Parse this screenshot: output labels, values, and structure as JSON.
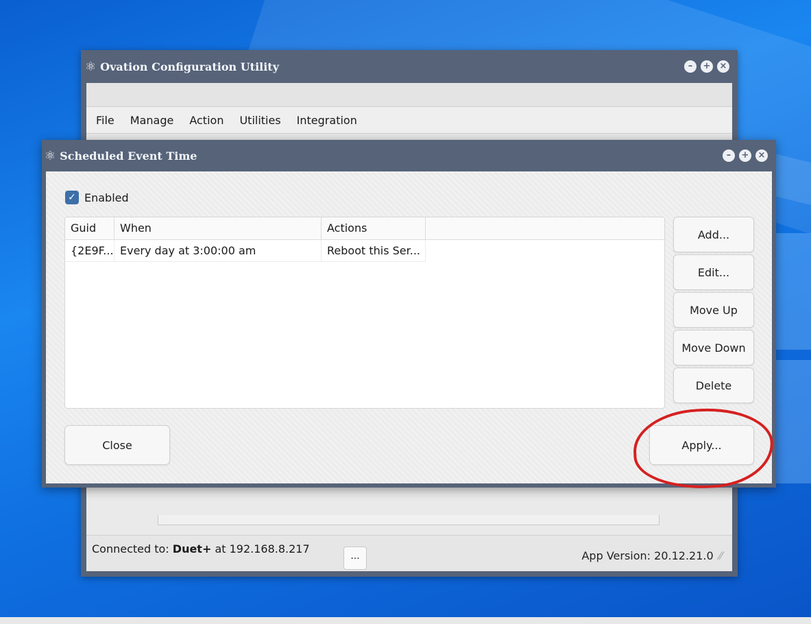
{
  "main_window": {
    "title": "Ovation Configuration Utility",
    "menu": [
      "File",
      "Manage",
      "Action",
      "Utilities",
      "Integration"
    ],
    "status": {
      "prefix": "Connected to: ",
      "device": "Duet+",
      "suffix": " at 192.168.8.217",
      "more_label": "...",
      "version": "App Version: 20.12.21.0"
    }
  },
  "dialog": {
    "title": "Scheduled Event Time",
    "enabled_label": "Enabled",
    "enabled_checked": true,
    "table": {
      "columns": [
        "Guid",
        "When",
        "Actions",
        ""
      ],
      "rows": [
        [
          "{2E9F...",
          "Every day at 3:00:00 am",
          "Reboot this Ser...",
          ""
        ]
      ]
    },
    "side_buttons": [
      "Add...",
      "Edit...",
      "Move Up",
      "Move Down",
      "Delete"
    ],
    "close_label": "Close",
    "apply_label": "Apply..."
  },
  "icons": {
    "app_icon": "atom-icon",
    "minimize": "minimize-icon",
    "maximize": "maximize-icon",
    "close": "close-icon"
  },
  "colors": {
    "titlebar": "#566379",
    "checkbox": "#3d6fa8",
    "annotation": "#d62020"
  }
}
